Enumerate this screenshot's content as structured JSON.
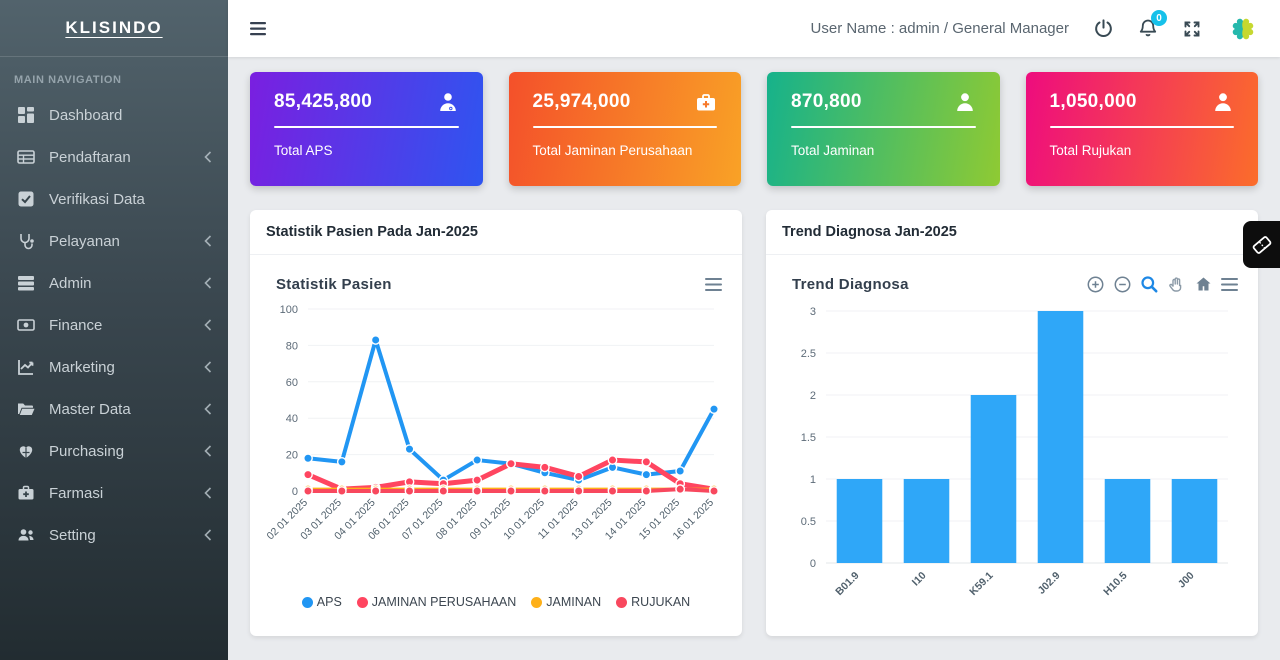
{
  "sidebar": {
    "brand": "KLISINDO",
    "section_label": "MAIN NAVIGATION",
    "items": [
      {
        "label": "Dashboard",
        "icon": "dashboard-grid-icon",
        "has_submenu": false
      },
      {
        "label": "Pendaftaran",
        "icon": "registration-table-icon",
        "has_submenu": true
      },
      {
        "label": "Verifikasi Data",
        "icon": "check-square-icon",
        "has_submenu": false
      },
      {
        "label": "Pelayanan",
        "icon": "stethoscope-icon",
        "has_submenu": true
      },
      {
        "label": "Admin",
        "icon": "server-icon",
        "has_submenu": true
      },
      {
        "label": "Finance",
        "icon": "money-bill-icon",
        "has_submenu": true
      },
      {
        "label": "Marketing",
        "icon": "chart-line-icon",
        "has_submenu": true
      },
      {
        "label": "Master Data",
        "icon": "folder-open-icon",
        "has_submenu": true
      },
      {
        "label": "Purchasing",
        "icon": "heart-box-icon",
        "has_submenu": true
      },
      {
        "label": "Farmasi",
        "icon": "medkit-icon",
        "has_submenu": true
      },
      {
        "label": "Setting",
        "icon": "users-gear-icon",
        "has_submenu": true
      }
    ]
  },
  "topbar": {
    "user_text": "User Name : admin / General Manager",
    "notification_badge": "0"
  },
  "stat_cards": [
    {
      "value": "85,425,800",
      "label": "Total APS",
      "icon": "doctor-icon",
      "gradient_from": "#7a1fe0",
      "gradient_to": "#2e55f0"
    },
    {
      "value": "25,974,000",
      "label": "Total Jaminan Perusahaan",
      "icon": "medkit-icon",
      "gradient_from": "#f4502a",
      "gradient_to": "#f9a226"
    },
    {
      "value": "870,800",
      "label": "Total Jaminan",
      "icon": "user-icon",
      "gradient_from": "#16b28b",
      "gradient_to": "#8fca33"
    },
    {
      "value": "1,050,000",
      "label": "Total Rujukan",
      "icon": "user-icon",
      "gradient_from": "#ee0c7e",
      "gradient_to": "#fb6d2a"
    }
  ],
  "panels": {
    "left": {
      "header": "Statistik Pasien Pada Jan-2025"
    },
    "right": {
      "header": "Trend Diagnosa Jan-2025"
    }
  },
  "chart_data": [
    {
      "type": "line",
      "title": "Statistik Pasien",
      "x": [
        "02 01 2025",
        "03 01 2025",
        "04 01 2025",
        "06 01 2025",
        "07 01 2025",
        "08 01 2025",
        "09 01 2025",
        "10 01 2025",
        "11 01 2025",
        "13 01 2025",
        "14 01 2025",
        "15 01 2025",
        "16 01 2025"
      ],
      "series": [
        {
          "name": "APS",
          "color": "#2196f3",
          "values": [
            18,
            16,
            83,
            23,
            6,
            17,
            15,
            10,
            6,
            13,
            9,
            11,
            45
          ]
        },
        {
          "name": "JAMINAN PERUSAHAAN",
          "color": "#ff4560",
          "values": [
            9,
            1,
            2,
            5,
            4,
            6,
            15,
            13,
            8,
            17,
            16,
            4,
            1
          ]
        },
        {
          "name": "JAMINAN",
          "color": "#feb019",
          "values": [
            1,
            1,
            1,
            1,
            1,
            1,
            1,
            1,
            1,
            1,
            1,
            1,
            1
          ]
        },
        {
          "name": "RUJUKAN",
          "color": "#f8485e",
          "values": [
            0,
            0,
            0,
            0,
            0,
            0,
            0,
            0,
            0,
            0,
            0,
            1,
            0
          ]
        }
      ],
      "ylim": [
        0,
        100
      ],
      "yticks": [
        0,
        20,
        40,
        60,
        80,
        100
      ],
      "grid": true,
      "legend_position": "bottom"
    },
    {
      "type": "bar",
      "title": "Trend Diagnosa",
      "categories": [
        "B01.9",
        "I10",
        "K59.1",
        "J02.9",
        "H10.5",
        "J00"
      ],
      "values": [
        1,
        1,
        2,
        3,
        1,
        1
      ],
      "color": "#2fa7f8",
      "ylim": [
        0,
        3
      ],
      "yticks": [
        0,
        0.5,
        1,
        1.5,
        2,
        2.5,
        3
      ],
      "grid": true
    }
  ]
}
